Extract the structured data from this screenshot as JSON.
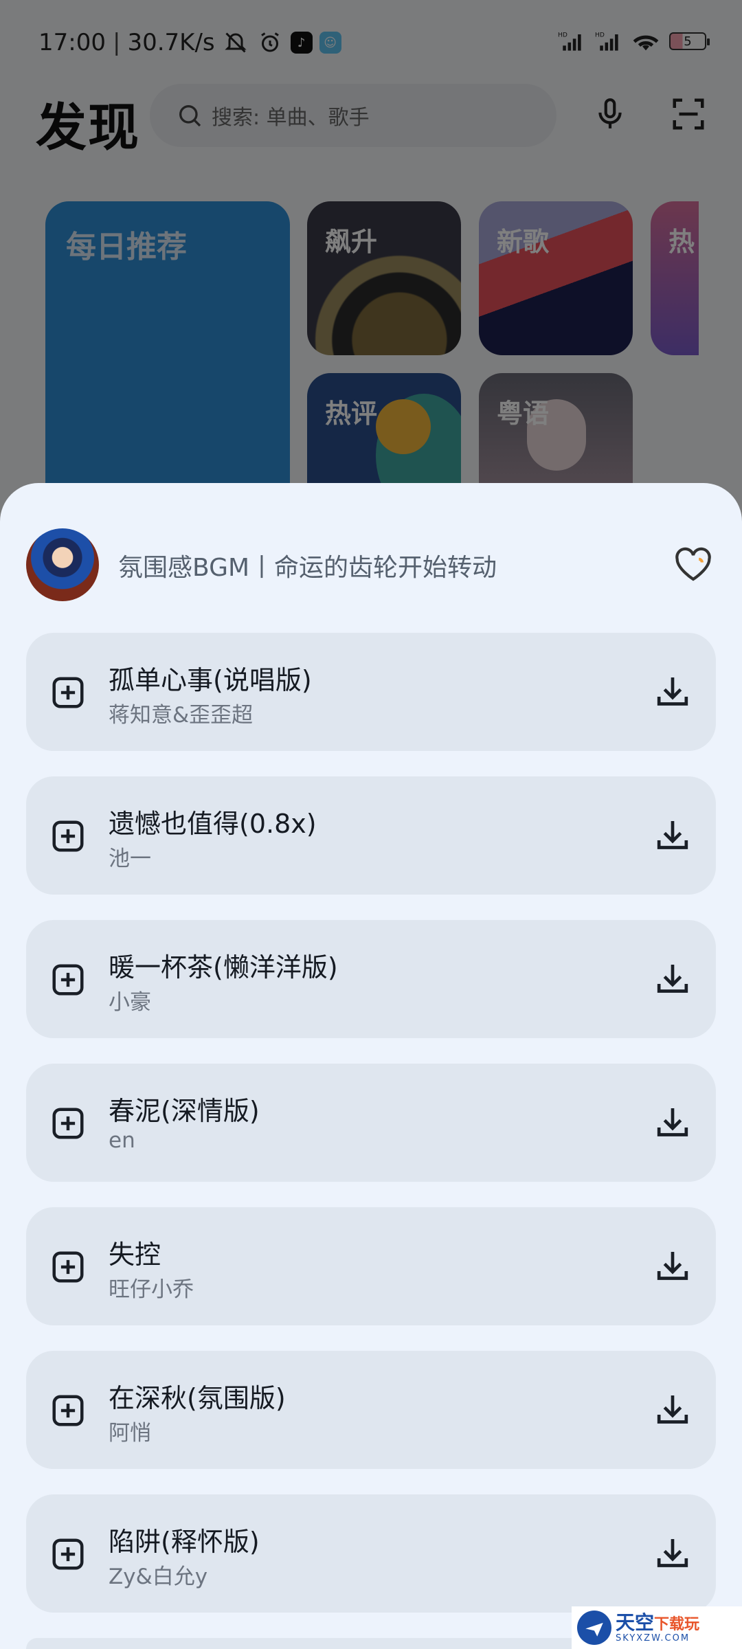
{
  "status_bar": {
    "time": "17:00",
    "net_speed": "30.7K/s",
    "battery_level": "5",
    "icons": [
      "mute-bell-icon",
      "alarm-icon",
      "douyin-icon",
      "qq-icon",
      "signal-hd-icon",
      "signal-hd-icon",
      "wifi-icon",
      "battery-icon"
    ]
  },
  "header": {
    "title": "发现",
    "search_placeholder": "搜索: 单曲、歌手"
  },
  "cards": {
    "daily": "每日推荐",
    "rise": "飙升",
    "new": "新歌",
    "hot": "热",
    "review": "热评",
    "canto": "粤语"
  },
  "sheet": {
    "playlist_title": "氛围感BGM丨命运的齿轮开始转动",
    "songs": [
      {
        "title": "孤单心事(说唱版)",
        "artist": "蒋知意&歪歪超"
      },
      {
        "title": "遗憾也值得(0.8x)",
        "artist": "池一"
      },
      {
        "title": "暖一杯茶(懒洋洋版)",
        "artist": "小豪"
      },
      {
        "title": "春泥(深情版)",
        "artist": "en"
      },
      {
        "title": "失控",
        "artist": "旺仔小乔"
      },
      {
        "title": "在深秋(氛围版)",
        "artist": "阿悄"
      },
      {
        "title": "陷阱(释怀版)",
        "artist": "Zy&白允y"
      }
    ]
  },
  "watermark": {
    "main": "天空",
    "accent": "下载玩",
    "sub": "SKYXZW.COM"
  },
  "colors": {
    "sheet_bg": "#edf3fc",
    "song_card_bg": "#dfe6ef",
    "daily_card": "#2e8fd6"
  }
}
